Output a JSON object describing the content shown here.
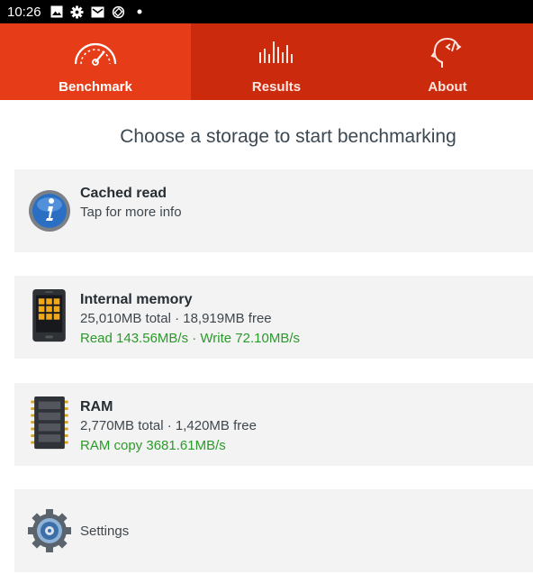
{
  "status_bar": {
    "time": "10:26",
    "icons": [
      "image-icon",
      "gear-icon",
      "mail-icon",
      "rotate-icon",
      "dot-icon"
    ]
  },
  "tabs": [
    {
      "label": "Benchmark",
      "icon": "speedometer-icon",
      "active": true
    },
    {
      "label": "Results",
      "icon": "bars-icon",
      "active": false
    },
    {
      "label": "About",
      "icon": "head-code-icon",
      "active": false
    }
  ],
  "heading": "Choose a storage to start benchmarking",
  "items": [
    {
      "title": "Cached read",
      "line1": "Tap for more info",
      "icon": "info-icon"
    },
    {
      "title": "Internal memory",
      "line1": "25,010MB total · 18,919MB free",
      "line2": "Read 143.56MB/s · Write 72.10MB/s",
      "icon": "phone-memory-icon"
    },
    {
      "title": "RAM",
      "line1": "2,770MB total · 1,420MB free",
      "line2": "RAM copy 3681.61MB/s",
      "icon": "ram-chip-icon"
    },
    {
      "title": "Settings",
      "icon": "settings-gear-icon"
    }
  ],
  "colors": {
    "tab_bar": "#cc2a0c",
    "tab_active": "#e63d18",
    "green": "#2a9a2a",
    "card": "#f3f3f3"
  }
}
